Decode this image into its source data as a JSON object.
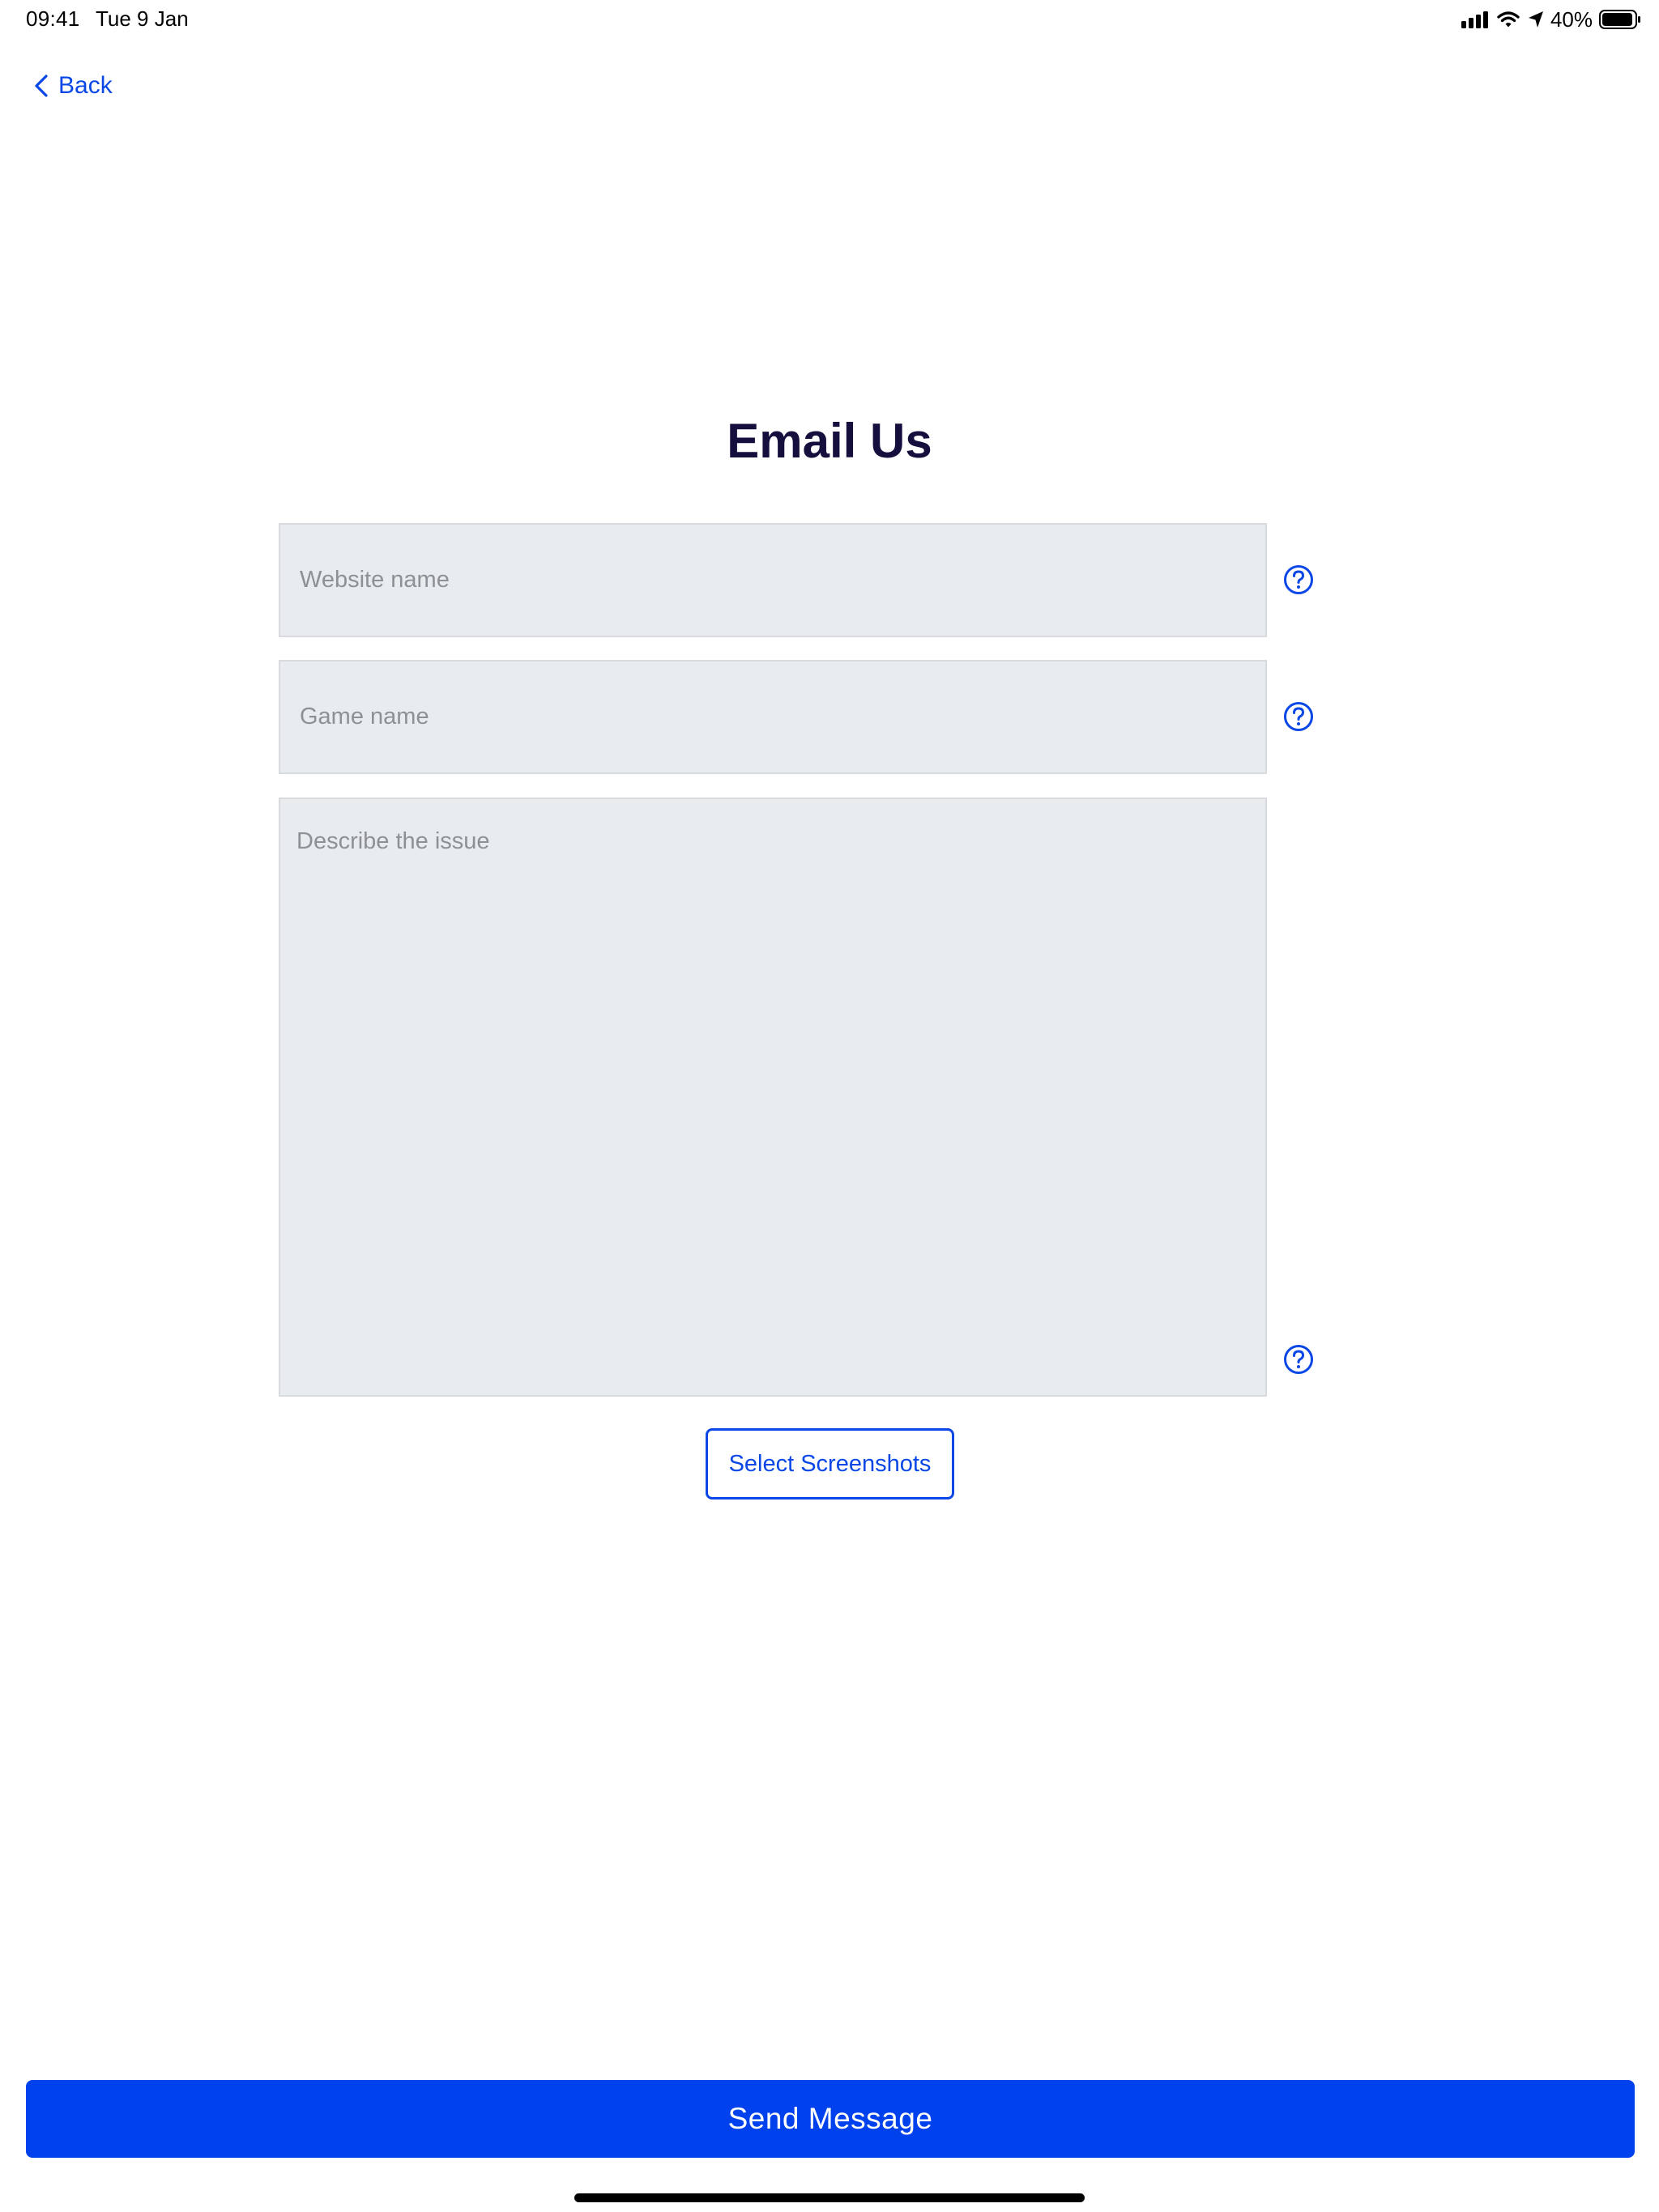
{
  "status_bar": {
    "time": "09:41",
    "date": "Tue 9 Jan",
    "battery_percent": "40%",
    "battery_level": 0.4,
    "icons": [
      "signal-icon",
      "wifi-icon",
      "location-icon",
      "battery-icon"
    ]
  },
  "nav": {
    "back_label": "Back",
    "back_icon": "chevron-left-icon"
  },
  "page": {
    "title": "Email Us"
  },
  "form": {
    "website": {
      "placeholder": "Website name",
      "value": ""
    },
    "game": {
      "placeholder": "Game name",
      "value": ""
    },
    "issue": {
      "placeholder": "Describe the issue",
      "value": ""
    },
    "help_icon": "question-circle-icon",
    "select_screenshots_label": "Select Screenshots",
    "send_label": "Send Message"
  },
  "colors": {
    "accent": "#0a47e6",
    "primary_button": "#0041ee",
    "title": "#150f3e",
    "field_background": "#e9ecef",
    "placeholder": "#8d9096"
  }
}
